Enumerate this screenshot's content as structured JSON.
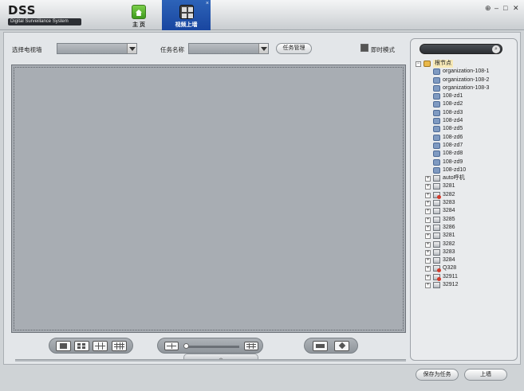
{
  "app": {
    "logo_title": "DSS",
    "logo_subtitle": "Digital Surveillance System"
  },
  "tabs": [
    {
      "label": "主 页",
      "icon": "home-icon"
    },
    {
      "label": "视频上墙",
      "icon": "video-wall-icon",
      "close": "×"
    }
  ],
  "window_controls": {
    "pin": "⊕",
    "minimize": "–",
    "restore": "□",
    "close": "✕"
  },
  "toolbar": {
    "select_tv_wall_label": "选择电视墙",
    "select_tv_wall_value": "",
    "task_name_label": "任务名称",
    "task_name_value": "",
    "task_manage_button": "任务管理",
    "instant_mode_label": "即时模式"
  },
  "tree": {
    "search_placeholder": "",
    "nodes": [
      {
        "level": 0,
        "expander": "−",
        "icon": "root",
        "label": "根节点",
        "root": true
      },
      {
        "level": 1,
        "expander": "",
        "icon": "org",
        "label": "organization-108-1"
      },
      {
        "level": 1,
        "expander": "",
        "icon": "org",
        "label": "organization-108-2"
      },
      {
        "level": 1,
        "expander": "",
        "icon": "org",
        "label": "organization-108-3"
      },
      {
        "level": 1,
        "expander": "",
        "icon": "org",
        "label": "108-zd1"
      },
      {
        "level": 1,
        "expander": "",
        "icon": "org",
        "label": "108-zd2"
      },
      {
        "level": 1,
        "expander": "",
        "icon": "org",
        "label": "108-zd3"
      },
      {
        "level": 1,
        "expander": "",
        "icon": "org",
        "label": "108-zd4"
      },
      {
        "level": 1,
        "expander": "",
        "icon": "org",
        "label": "108-zd5"
      },
      {
        "level": 1,
        "expander": "",
        "icon": "org",
        "label": "108-zd6"
      },
      {
        "level": 1,
        "expander": "",
        "icon": "org",
        "label": "108-zd7"
      },
      {
        "level": 1,
        "expander": "",
        "icon": "org",
        "label": "108-zd8"
      },
      {
        "level": 1,
        "expander": "",
        "icon": "org",
        "label": "108-zd9"
      },
      {
        "level": 1,
        "expander": "",
        "icon": "org",
        "label": "108-zd10"
      },
      {
        "level": 1,
        "expander": "+",
        "icon": "dev",
        "label": "auto呼机"
      },
      {
        "level": 1,
        "expander": "+",
        "icon": "dev",
        "label": "3281"
      },
      {
        "level": 1,
        "expander": "+",
        "icon": "err",
        "label": "3282"
      },
      {
        "level": 1,
        "expander": "+",
        "icon": "dev",
        "label": "3283"
      },
      {
        "level": 1,
        "expander": "+",
        "icon": "dev",
        "label": "3284"
      },
      {
        "level": 1,
        "expander": "+",
        "icon": "dev",
        "label": "3285"
      },
      {
        "level": 1,
        "expander": "+",
        "icon": "dev",
        "label": "3286"
      },
      {
        "level": 1,
        "expander": "+",
        "icon": "dev",
        "label": "3281"
      },
      {
        "level": 1,
        "expander": "+",
        "icon": "dev",
        "label": "3282"
      },
      {
        "level": 1,
        "expander": "+",
        "icon": "dev",
        "label": "3283"
      },
      {
        "level": 1,
        "expander": "+",
        "icon": "dev",
        "label": "3284"
      },
      {
        "level": 1,
        "expander": "+",
        "icon": "err",
        "label": "Q328"
      },
      {
        "level": 1,
        "expander": "+",
        "icon": "err",
        "label": "32911"
      },
      {
        "level": 1,
        "expander": "+",
        "icon": "dev",
        "label": "32912"
      }
    ]
  },
  "bottom": {
    "collapse_glyph": "︿",
    "layout_buttons": [
      "layout-1x1-icon",
      "layout-2x2-icon",
      "layout-3x3-icon",
      "layout-4x4-icon"
    ],
    "zoom_level": 0.0
  },
  "footer": {
    "save_task_button": "保存为任务",
    "upload_wall_button": "上墙"
  }
}
